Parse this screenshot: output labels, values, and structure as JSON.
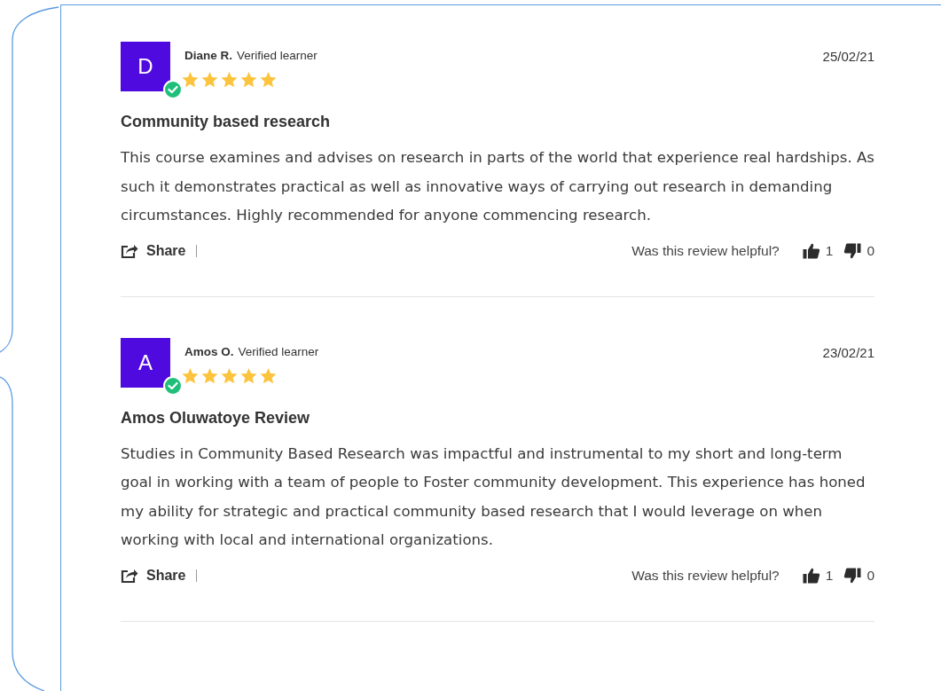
{
  "reviews": [
    {
      "initial": "D",
      "name": "Diane R.",
      "badge": "Verified learner",
      "verified": true,
      "stars": 5,
      "date": "25/02/21",
      "title": "Community based research",
      "body": "This course examines and advises on research in parts of the world that experience real hardships. As such it demonstrates practical as well as innovative ways of carrying out research in demanding circumstances. Highly recommended for anyone commencing research.",
      "share": "Share",
      "helpful": "Was this review helpful?",
      "up": "1",
      "down": "0"
    },
    {
      "initial": "A",
      "name": "Amos O.",
      "badge": "Verified learner",
      "verified": true,
      "stars": 5,
      "date": "23/02/21",
      "title": "Amos Oluwatoye Review",
      "body": "Studies in Community Based Research was impactful and instrumental to my short and long-term goal in working with a team of people to Foster community development. This experience has honed my ability for strategic and practical community based research that I would leverage on when working with local and international organizations.",
      "share": "Share",
      "helpful": "Was this review helpful?",
      "up": "1",
      "down": "0"
    }
  ]
}
